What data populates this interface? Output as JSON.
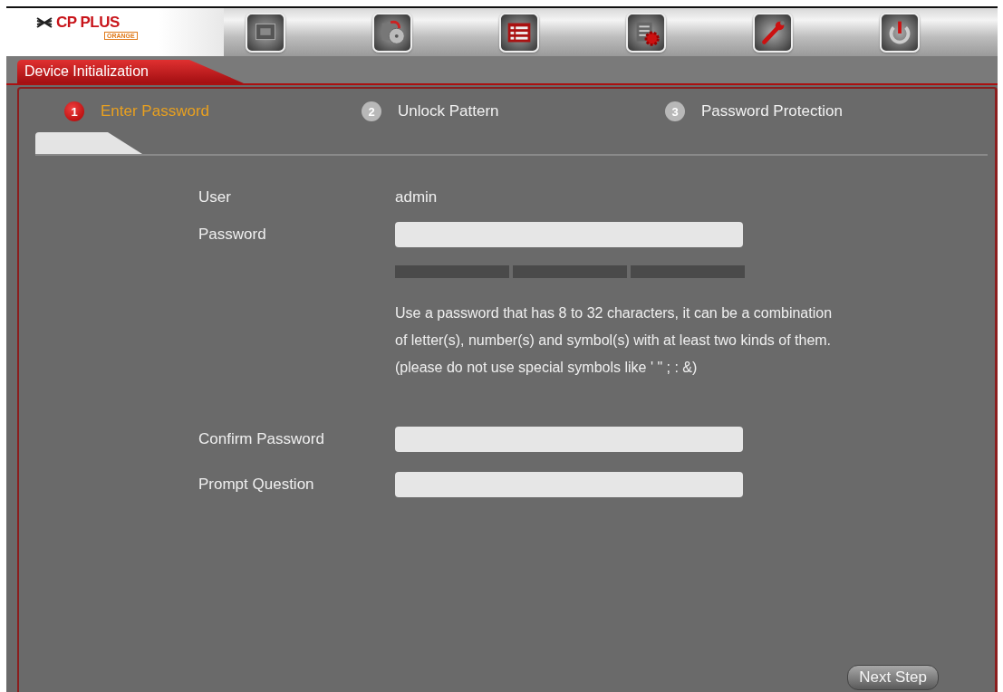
{
  "logo": {
    "brand": "CP PLUS",
    "sub": "ORANGE"
  },
  "window": {
    "title": "Device Initialization"
  },
  "steps": [
    {
      "number": "1",
      "label": "Enter Password",
      "selected": true
    },
    {
      "number": "2",
      "label": "Unlock Pattern",
      "selected": false
    },
    {
      "number": "3",
      "label": "Password Protection",
      "selected": false
    }
  ],
  "form": [
    {
      "kind": "text",
      "label": "User",
      "value": "admin"
    },
    {
      "kind": "input",
      "label": "Password"
    },
    {
      "kind": "meter"
    },
    {
      "kind": "note",
      "text": "Use a password that has 8 to 32 characters, it can be a combination of letter(s), number(s) and symbol(s) with at least two kinds of them.(please do not use special symbols like ' \" ; : &)"
    },
    {
      "kind": "input",
      "label": "Confirm Password"
    },
    {
      "kind": "input",
      "label": "Prompt Question"
    }
  ],
  "buttons": [
    "Next Step"
  ]
}
